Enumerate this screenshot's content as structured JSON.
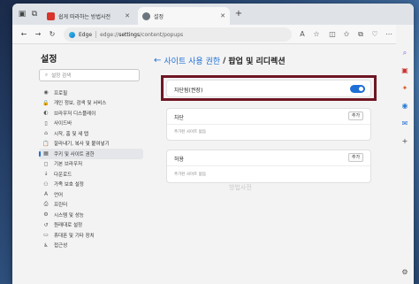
{
  "browser": {
    "tabs": [
      {
        "title": "쉽게 따라하는 방법사전",
        "active": false
      },
      {
        "title": "설정",
        "active": true
      }
    ],
    "address": {
      "brand": "Edge",
      "url_prefix": "edge://",
      "url_main": "settings",
      "url_suffix": "/content/popups"
    }
  },
  "sidebar": {
    "title": "설정",
    "search_placeholder": "설정 검색",
    "items": [
      {
        "label": "프로필",
        "icon": "profile-icon",
        "glyph": "◉"
      },
      {
        "label": "개인 정보, 검색 및 서비스",
        "icon": "lock-icon",
        "glyph": "🔒"
      },
      {
        "label": "브라우저 디스플레이",
        "icon": "display-icon",
        "glyph": "◐"
      },
      {
        "label": "사이드바",
        "icon": "sidebar-icon",
        "glyph": "▯"
      },
      {
        "label": "시작, 홈 및 새 탭",
        "icon": "home-icon",
        "glyph": "⌂"
      },
      {
        "label": "잘라내기, 복사 및 붙여넣기",
        "icon": "clipboard-icon",
        "glyph": "📋"
      },
      {
        "label": "쿠키 및 사이트 권한",
        "icon": "cookie-icon",
        "glyph": "▦",
        "active": true
      },
      {
        "label": "기본 브라우저",
        "icon": "browser-icon",
        "glyph": "◻"
      },
      {
        "label": "다운로드",
        "icon": "download-icon",
        "glyph": "↓"
      },
      {
        "label": "가족 보호 설정",
        "icon": "family-icon",
        "glyph": "⚇"
      },
      {
        "label": "언어",
        "icon": "language-icon",
        "glyph": "A"
      },
      {
        "label": "프린터",
        "icon": "printer-icon",
        "glyph": "⎙"
      },
      {
        "label": "시스템 및 성능",
        "icon": "system-icon",
        "glyph": "⚙"
      },
      {
        "label": "원래대로 설정",
        "icon": "reset-icon",
        "glyph": "↺"
      },
      {
        "label": "휴대폰 및 기타 장치",
        "icon": "phone-icon",
        "glyph": "▭"
      },
      {
        "label": "접근성",
        "icon": "accessibility-icon",
        "glyph": "♿"
      }
    ]
  },
  "content": {
    "breadcrumb": "사이트 사용 권한",
    "separator": "/",
    "page_title": "팝업 및 리디렉션",
    "toggle_label": "차단됨(권장)",
    "toggle_on": true,
    "block_section": {
      "title": "차단",
      "add_label": "추가",
      "empty_text": "추가된 사이트 없음"
    },
    "allow_section": {
      "title": "허용",
      "add_label": "추가",
      "empty_text": "추가된 사이트 없음"
    }
  },
  "watermark": "방법사전",
  "colors": {
    "accent": "#1d6fd6",
    "highlight_border": "#6f1623"
  }
}
